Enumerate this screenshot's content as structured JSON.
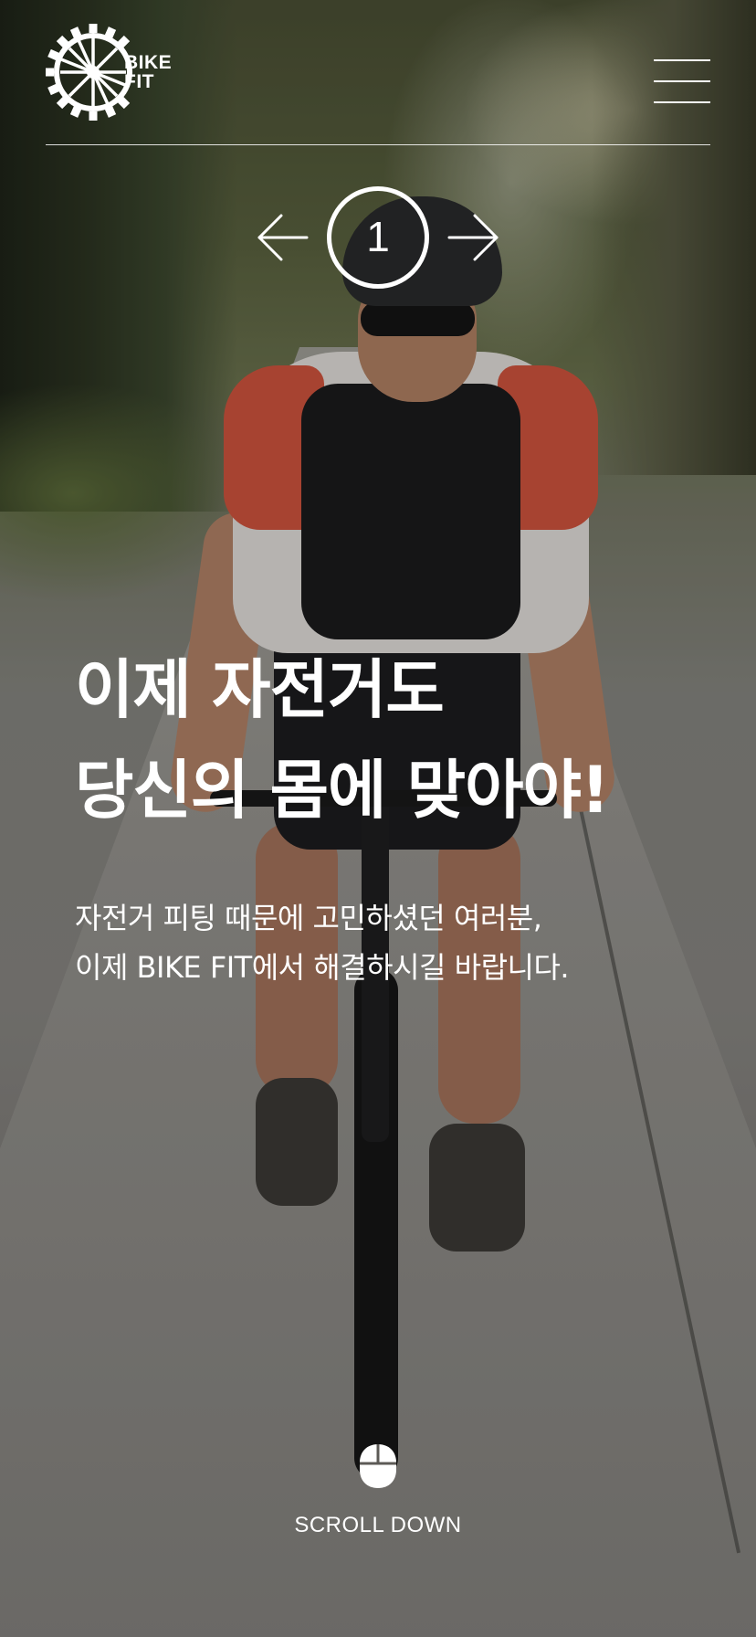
{
  "brand": {
    "logo_line1": "BIKE",
    "logo_line2": "FIT",
    "logo_icon": "bike-wheel-gear-icon"
  },
  "header": {
    "menu_icon": "hamburger-menu-icon"
  },
  "slider": {
    "current_slide": "1",
    "prev_icon": "arrow-left-icon",
    "next_icon": "arrow-right-icon"
  },
  "hero": {
    "title_line1": "이제 자전거도",
    "title_line2": "당신의 몸에 맞아야!",
    "desc_line1": "자전거 피팅 때문에 고민하셨던 여러분,",
    "desc_line2": "이제 BIKE FIT에서 해결하시길 바랍니다."
  },
  "scroll": {
    "label": "SCROLL DOWN",
    "icon": "mouse-icon"
  },
  "colors": {
    "text": "#ffffff",
    "overlay": "rgba(0,0,0,0.22)"
  }
}
